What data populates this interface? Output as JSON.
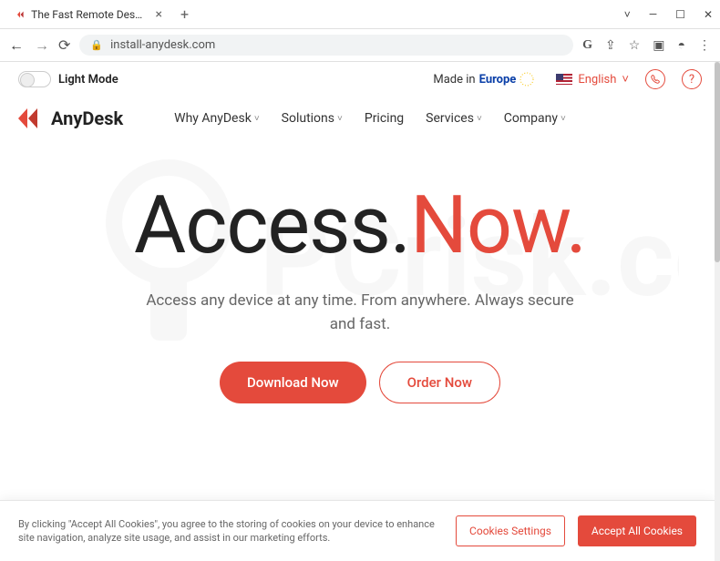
{
  "browser": {
    "tab_title": "The Fast Remote Desktop Applic",
    "url": "install-anydesk.com",
    "icons": {
      "google": "G",
      "share": "⇪",
      "star": "☆",
      "ext": "▣",
      "profile": "◓",
      "menu": "⋮"
    },
    "win": {
      "v": "˅",
      "min": "—",
      "max": "☐",
      "close": "✕"
    }
  },
  "topstrip": {
    "lightmode": "Light Mode",
    "made_in_prefix": "Made in ",
    "made_in_region": "Europe",
    "language": "English"
  },
  "brand": "AnyDesk",
  "nav": [
    {
      "label": "Why AnyDesk",
      "dropdown": true
    },
    {
      "label": "Solutions",
      "dropdown": true
    },
    {
      "label": "Pricing",
      "dropdown": false
    },
    {
      "label": "Services",
      "dropdown": true
    },
    {
      "label": "Company",
      "dropdown": true
    }
  ],
  "hero": {
    "title_1": "Access.",
    "title_2": "Now.",
    "subtitle": "Access any device at any time. From anywhere. Always secure and fast.",
    "cta_primary": "Download Now",
    "cta_secondary": "Order Now"
  },
  "cookie": {
    "text": "By clicking \"Accept All Cookies\", you agree to the storing of cookies on your device to enhance site navigation, analyze site usage, and assist in our marketing efforts.",
    "settings": "Cookies Settings",
    "accept": "Accept All Cookies"
  }
}
